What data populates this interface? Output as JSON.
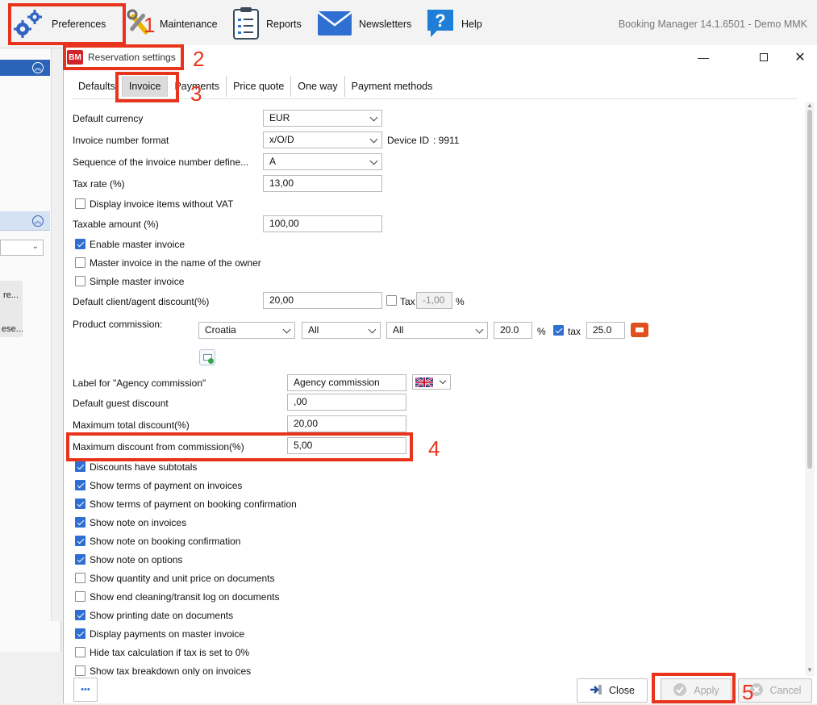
{
  "toolbar": {
    "preferences": "Preferences",
    "maintenance": "Maintenance",
    "reports": "Reports",
    "newsletters": "Newsletters",
    "help": "Help",
    "app_title": "Booking Manager 14.1.6501 - Demo MMK"
  },
  "background": {
    "item1": "re...",
    "item2": "ese..."
  },
  "dialog": {
    "title": "Reservation settings",
    "icon_text": "BM",
    "tabs": [
      "Defaults",
      "Invoice",
      "Payments",
      "Price quote",
      "One way",
      "Payment methods"
    ],
    "active_tab": "Invoice"
  },
  "form": {
    "default_currency": {
      "label": "Default currency",
      "value": "EUR"
    },
    "invoice_number_format": {
      "label": "Invoice number format",
      "value": "x/O/D"
    },
    "device_id": {
      "label": "Device ID",
      "value": ": 9911"
    },
    "sequence": {
      "label": "Sequence of the invoice number define...",
      "value": "A"
    },
    "tax_rate": {
      "label": "Tax rate  (%)",
      "value": "13,00"
    },
    "display_items_without_vat": {
      "label": "Display invoice items without VAT",
      "checked": false
    },
    "taxable_amount": {
      "label": "Taxable amount (%)",
      "value": "100,00"
    },
    "enable_master_invoice": {
      "label": "Enable master invoice",
      "checked": true
    },
    "master_invoice_owner": {
      "label": "Master invoice in the name of the owner",
      "checked": false
    },
    "simple_master_invoice": {
      "label": "Simple master invoice",
      "checked": false
    },
    "default_discount": {
      "label": "Default client/agent discount(%)",
      "value": "20,00",
      "tax_label": "Tax",
      "tax_value": "-1,00",
      "percent": "%"
    },
    "product_commission": {
      "label": "Product commission:",
      "country": "Croatia",
      "sel2": "All",
      "sel3": "All",
      "value": "20.0",
      "percent": "%",
      "tax_label": "tax",
      "tax_value": "25.0"
    },
    "agency_commission_label": {
      "label": "Label for \"Agency commission\"",
      "value": "Agency commission"
    },
    "default_guest_discount": {
      "label": "Default guest discount",
      "value": ",00"
    },
    "max_total_discount": {
      "label": "Maximum total discount(%)",
      "value": "20,00"
    },
    "max_discount_commission": {
      "label": "Maximum discount from commission(%)",
      "value": "5,00"
    }
  },
  "checkboxes": [
    {
      "label": "Discounts have subtotals",
      "checked": true
    },
    {
      "label": "Show terms of payment on invoices",
      "checked": true
    },
    {
      "label": "Show terms of payment on booking confirmation",
      "checked": true
    },
    {
      "label": "Show note on invoices",
      "checked": true
    },
    {
      "label": "Show note on booking confirmation",
      "checked": true
    },
    {
      "label": "Show note on options",
      "checked": true
    },
    {
      "label": "Show quantity and unit price on documents",
      "checked": false
    },
    {
      "label": "Show end cleaning/transit log on documents",
      "checked": false
    },
    {
      "label": "Show printing date on documents",
      "checked": true
    },
    {
      "label": "Display payments on master invoice",
      "checked": true
    },
    {
      "label": "Hide tax calculation if tax is set to 0%",
      "checked": false
    },
    {
      "label": "Show tax breakdown only on invoices",
      "checked": false
    }
  ],
  "footer": {
    "more": "•••",
    "close": "Close",
    "apply": "Apply",
    "cancel": "Cancel"
  },
  "annotations": [
    "1",
    "2",
    "3",
    "4",
    "5"
  ],
  "colors": {
    "accent": "#2f6fd1",
    "annotation": "#e8341c",
    "title_icon": "#d3232a"
  }
}
